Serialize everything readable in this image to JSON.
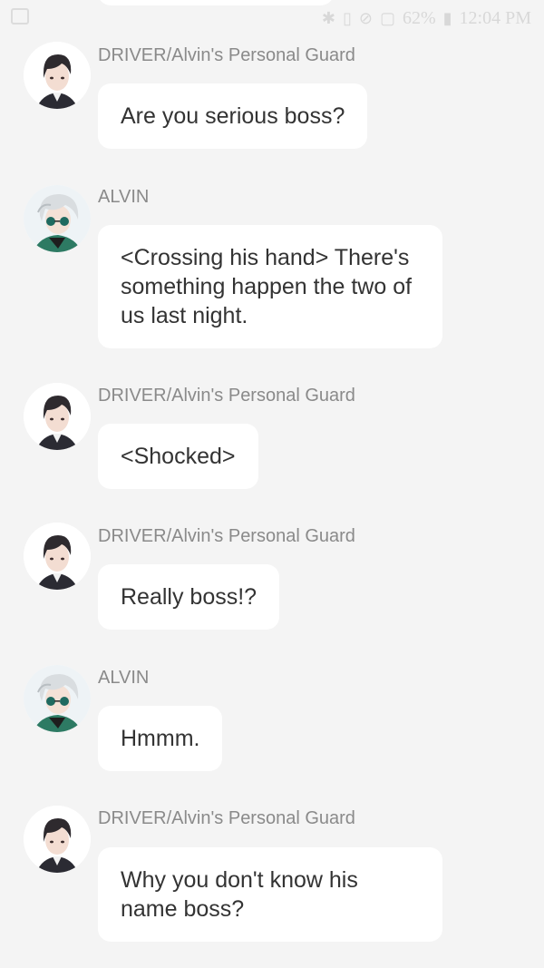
{
  "status_bar": {
    "battery": "62%",
    "time": "12:04 PM",
    "icons": [
      "bluetooth-icon",
      "vibrate-icon",
      "blocked-icon",
      "nfc-icon",
      "battery-icon"
    ]
  },
  "messages": [
    {
      "sender": "DRIVER/Alvin's Personal Guard",
      "avatar": "driver-avatar",
      "text": "Are you serious boss?"
    },
    {
      "sender": "ALVIN",
      "avatar": "alvin-avatar",
      "text": "<Crossing his hand> There's something happen the two of us last night."
    },
    {
      "sender": "DRIVER/Alvin's Personal Guard",
      "avatar": "driver-avatar",
      "text": "<Shocked>"
    },
    {
      "sender": "DRIVER/Alvin's Personal Guard",
      "avatar": "driver-avatar",
      "text": "Really boss!?"
    },
    {
      "sender": "ALVIN",
      "avatar": "alvin-avatar",
      "text": "Hmmm."
    },
    {
      "sender": "DRIVER/Alvin's Personal Guard",
      "avatar": "driver-avatar",
      "text": "Why you don't know his name boss?"
    }
  ]
}
